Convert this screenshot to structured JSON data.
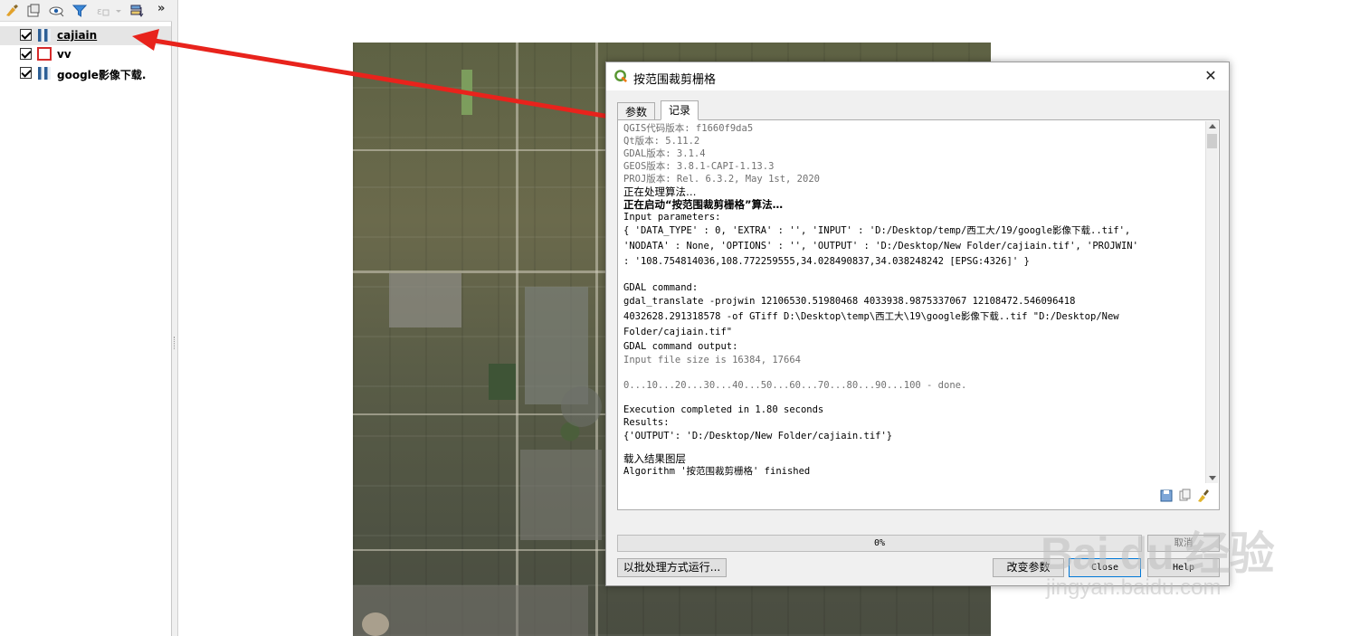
{
  "layers_panel": {
    "toolbar_more": "»",
    "layers": [
      {
        "name": "cajiain",
        "checked": true,
        "type": "raster",
        "selected": true
      },
      {
        "name": "vv",
        "checked": true,
        "type": "polygon",
        "selected": false
      },
      {
        "name": "google影像下载.",
        "checked": true,
        "type": "raster",
        "selected": false
      }
    ]
  },
  "dialog": {
    "title": "按范围裁剪栅格",
    "close_glyph": "✕",
    "tabs": [
      {
        "label": "参数",
        "active": false
      },
      {
        "label": "记录",
        "active": true
      }
    ],
    "log": {
      "lines_top": [
        "QGIS代码版本: f1660f9da5",
        "Qt版本: 5.11.2",
        "GDAL版本: 3.1.4",
        "GEOS版本: 3.8.1-CAPI-1.13.3",
        "PROJ版本: Rel. 6.3.2, May 1st, 2020"
      ],
      "processing": "正在处理算法…",
      "starting": "正在启动“按范围裁剪栅格”算法…",
      "input_label": "Input parameters:",
      "params": [
        "{ 'DATA_TYPE' : 0, 'EXTRA' : '', 'INPUT' : 'D:/Desktop/temp/西工大/19/google影像下载..tif',",
        "'NODATA' : None, 'OPTIONS' : '', 'OUTPUT' : 'D:/Desktop/New Folder/cajiain.tif', 'PROJWIN'",
        ": '108.754814036,108.772259555,34.028490837,34.038248242 [EPSG:4326]' }"
      ],
      "gdal_cmd_label": "GDAL command:",
      "gdal_cmd": [
        "gdal_translate -projwin 12106530.51980468 4033938.9875337067 12108472.546096418",
        "4032628.291318578 -of GTiff D:\\Desktop\\temp\\西工大\\19\\google影像下载..tif \"D:/Desktop/New",
        "Folder/cajiain.tif\""
      ],
      "gdal_output_label": "GDAL command output:",
      "input_size": "Input file size is 16384, 17664",
      "progress_line": "0...10...20...30...40...50...60...70...80...90...100 - done.",
      "execution": "Execution completed in 1.80 seconds",
      "results_label": "Results:",
      "results": "{'OUTPUT': 'D:/Desktop/New Folder/cajiain.tif'}",
      "loading": "载入结果图层",
      "finished": "Algorithm '按范围裁剪栅格' finished"
    },
    "progress_text": "0%",
    "progress_fraction": 0,
    "cancel_label": "取消",
    "batch_label": "以批处理方式运行...",
    "change_params_label": "改变参数",
    "close_label": "Close",
    "help_label": "Help"
  },
  "watermark": {
    "main": "Bai du 经验",
    "sub": "jingyan.baidu.com"
  },
  "colors": {
    "arrow": "#e8231c",
    "focus_border": "#0078d7",
    "polygon_stroke": "#d62a2a"
  }
}
